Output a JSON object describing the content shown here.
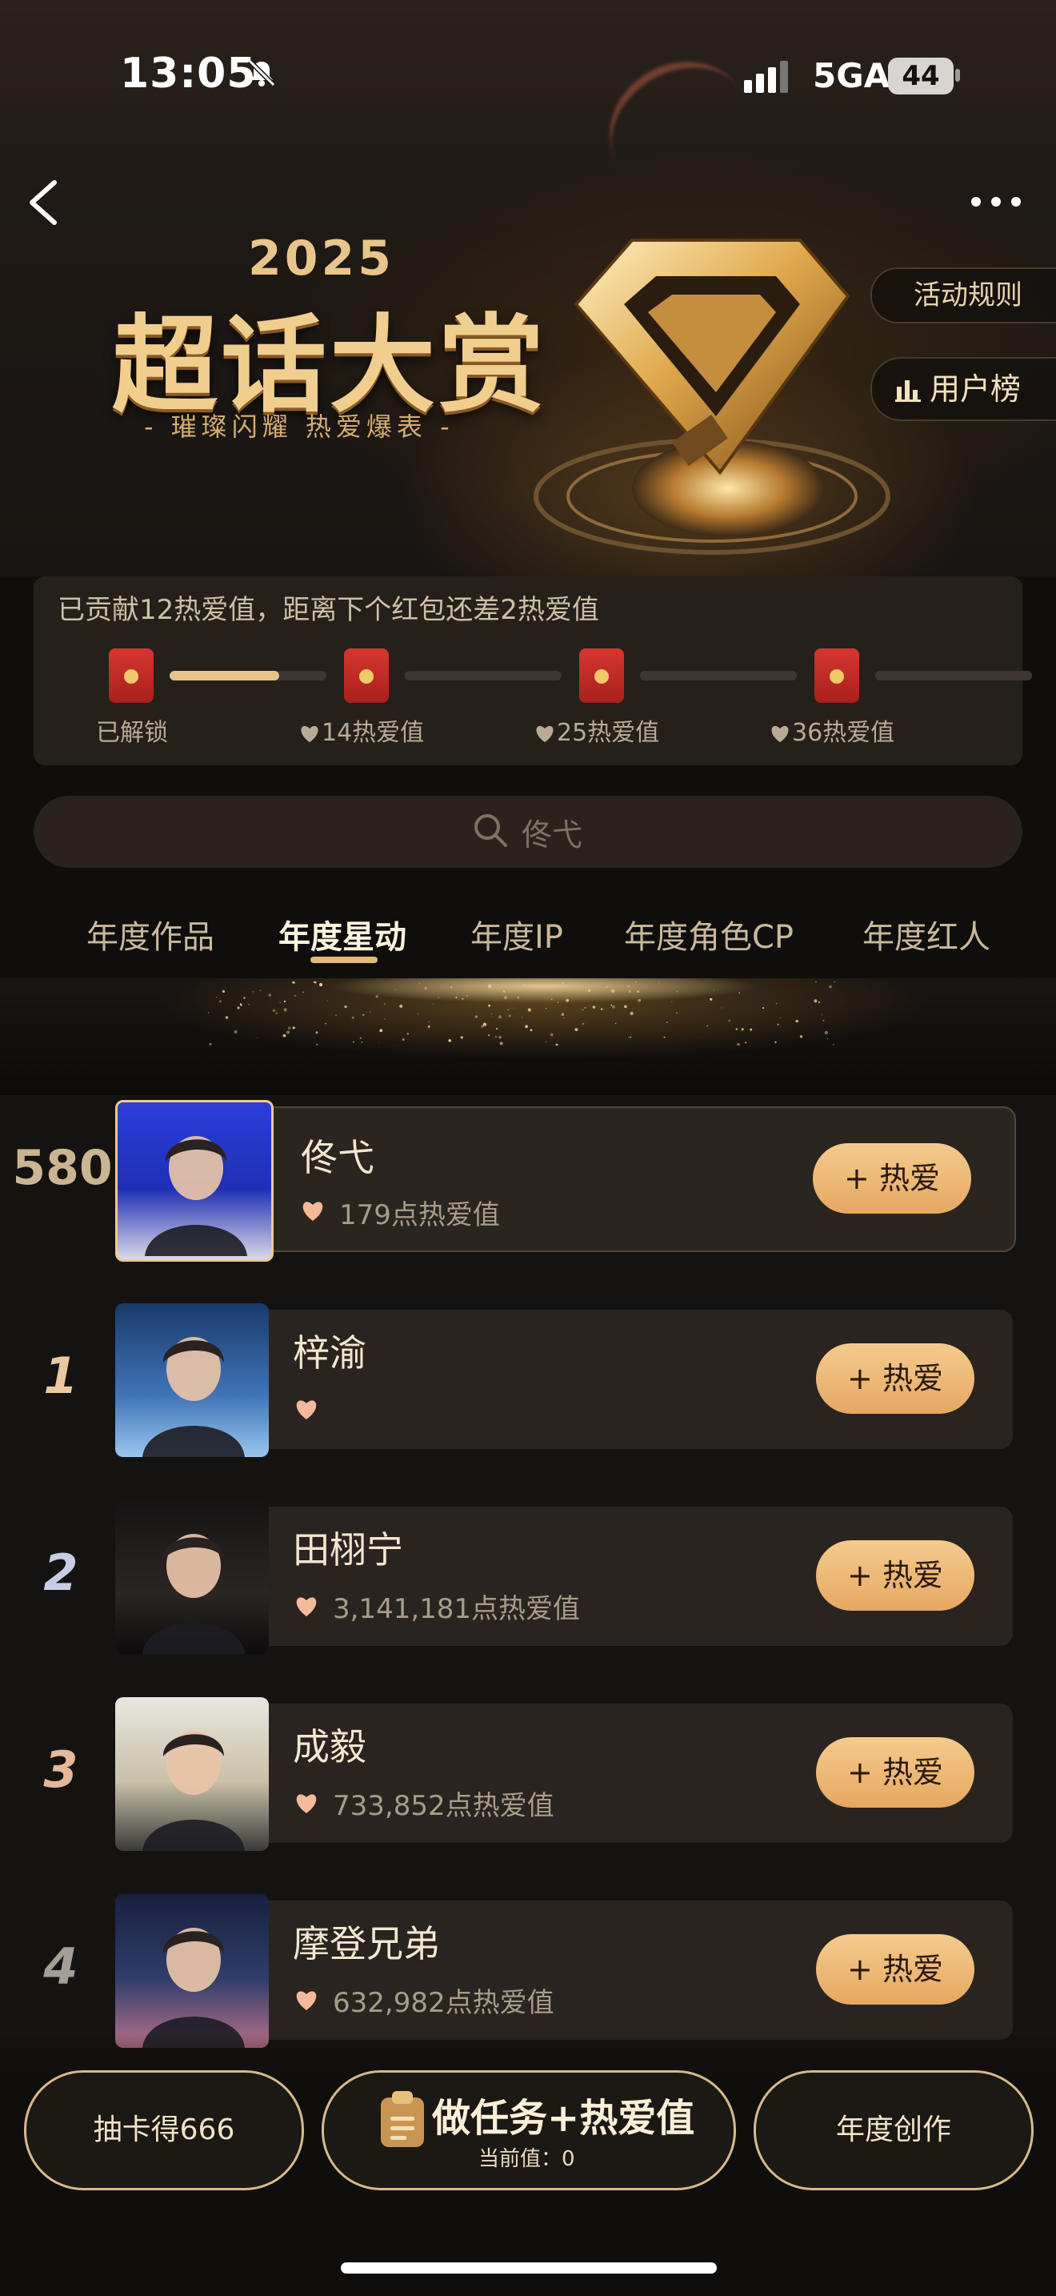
{
  "status": {
    "time": "13:05",
    "network": "5GA",
    "battery": "44"
  },
  "header": {
    "year": "2025",
    "title": "超话大赏",
    "slogan": "- 璀璨闪耀 热爱爆表 -",
    "rules_label": "活动规则",
    "users_label": "用户榜"
  },
  "progress": {
    "text": "已贡献12热爱值，距离下个红包还差2热爱值",
    "milestones": [
      {
        "label": "已解锁",
        "heart": false,
        "fill": 0.7
      },
      {
        "label": "14热爱值",
        "heart": true,
        "fill": 0
      },
      {
        "label": "25热爱值",
        "heart": true,
        "fill": 0
      },
      {
        "label": "36热爱值",
        "heart": true,
        "fill": 0
      }
    ]
  },
  "search": {
    "placeholder": "佟弋"
  },
  "tabs": [
    {
      "label": "年度作品",
      "active": false
    },
    {
      "label": "年度星动",
      "active": true
    },
    {
      "label": "年度IP",
      "active": false
    },
    {
      "label": "年度角色CP",
      "active": false
    },
    {
      "label": "年度红人",
      "active": false
    }
  ],
  "ranking": [
    {
      "rank": "580",
      "name": "佟弋",
      "score": "179点热爱值",
      "button": "+ 热爱",
      "mine": true
    },
    {
      "rank": "1",
      "name": "梓渝",
      "score": "",
      "button": "+ 热爱",
      "mine": false
    },
    {
      "rank": "2",
      "name": "田栩宁",
      "score": "3,141,181点热爱值",
      "button": "+ 热爱",
      "mine": false
    },
    {
      "rank": "3",
      "name": "成毅",
      "score": "733,852点热爱值",
      "button": "+ 热爱",
      "mine": false
    },
    {
      "rank": "4",
      "name": "摩登兄弟",
      "score": "632,982点热爱值",
      "button": "+ 热爱",
      "mine": false
    }
  ],
  "bottom": {
    "left_label": "抽卡得666",
    "task_label": "做任务+热爱值",
    "task_sub": "当前值：0",
    "right_label": "年度创作"
  },
  "colors": {
    "accent_gold": "#e6b979",
    "button_gold": "#f5cb8d",
    "rank_1": "#e8c9a0",
    "rank_2": "#c8cde6",
    "rank_3": "#e5b89a",
    "rank_4": "#a59e96"
  }
}
